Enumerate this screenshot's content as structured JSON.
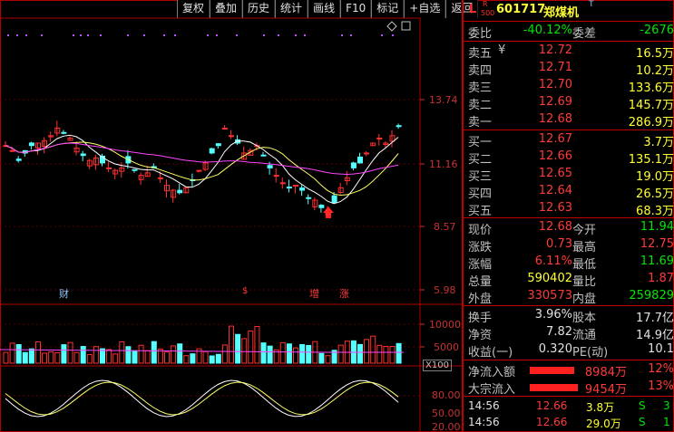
{
  "toolbar": [
    "复权",
    "叠加",
    "历史",
    "统计",
    "画线",
    "F10",
    "标记",
    "+自选",
    "返回"
  ],
  "price_axis": [
    "13.74",
    "11.16",
    "8.57",
    "5.98"
  ],
  "volume_axis": [
    "10000",
    "5000"
  ],
  "volume_unit": "X100",
  "kdj_axis": [
    "80.00",
    "50.00",
    "20.00"
  ],
  "markers": [
    "财",
    "$",
    "增",
    "涨"
  ],
  "quote": {
    "L": "L",
    "R": "R",
    "lot": "500",
    "code": "601717",
    "name": "郑煤机",
    "t": "T"
  },
  "weibi": {
    "label": "委比",
    "value": "-40.12%",
    "label2": "委差",
    "value2": "-2676"
  },
  "asks": [
    {
      "label": "卖五",
      "yen": "¥",
      "price": "12.72",
      "vol": "16.5万"
    },
    {
      "label": "卖四",
      "price": "12.71",
      "vol": "10.2万"
    },
    {
      "label": "卖三",
      "price": "12.70",
      "vol": "133.6万"
    },
    {
      "label": "卖二",
      "price": "12.69",
      "vol": "145.7万"
    },
    {
      "label": "卖一",
      "price": "12.68",
      "vol": "286.9万"
    }
  ],
  "bids": [
    {
      "label": "买一",
      "price": "12.67",
      "vol": "3.7万"
    },
    {
      "label": "买二",
      "price": "12.66",
      "vol": "135.1万"
    },
    {
      "label": "买三",
      "price": "12.65",
      "vol": "19.0万"
    },
    {
      "label": "买四",
      "price": "12.64",
      "vol": "26.5万"
    },
    {
      "label": "买五",
      "price": "12.63",
      "vol": "68.3万"
    }
  ],
  "stats": [
    {
      "l1": "现价",
      "v1": "12.68",
      "c1": "red",
      "l2": "今开",
      "v2": "11.94",
      "c2": "green"
    },
    {
      "l1": "涨跌",
      "v1": "0.73",
      "c1": "red",
      "l2": "最高",
      "v2": "12.75",
      "c2": "red"
    },
    {
      "l1": "涨幅",
      "v1": "6.11%",
      "c1": "red",
      "l2": "最低",
      "v2": "11.69",
      "c2": "green"
    },
    {
      "l1": "总量",
      "v1": "590402",
      "c1": "yellow",
      "l2": "量比",
      "v2": "1.87",
      "c2": "red"
    },
    {
      "l1": "外盘",
      "v1": "330573",
      "c1": "red",
      "l2": "内盘",
      "v2": "259829",
      "c2": "green"
    }
  ],
  "stats2": [
    {
      "l1": "换手",
      "v1": "3.96%",
      "c1": "white",
      "l2": "股本",
      "v2": "17.7亿",
      "c2": "white"
    },
    {
      "l1": "净资",
      "v1": "7.82",
      "c1": "white",
      "l2": "流通",
      "v2": "14.9亿",
      "c2": "white"
    },
    {
      "l1": "收益(一)",
      "v1": "0.320",
      "c1": "white",
      "l2": "PE(动)",
      "v2": "10.1",
      "c2": "white"
    }
  ],
  "flows": [
    {
      "label": "净流入额",
      "value": "8984万",
      "pct": "12%",
      "fill": 0.6
    },
    {
      "label": "大宗流入",
      "value": "9454万",
      "pct": "13%",
      "fill": 0.65
    }
  ],
  "ticks": [
    {
      "time": "14:56",
      "price": "12.66",
      "vol": "3.8万",
      "side": "S",
      "num": "3"
    },
    {
      "time": "14:56",
      "price": "12.66",
      "vol": "29.0万",
      "side": "S",
      "num": "1"
    }
  ]
}
